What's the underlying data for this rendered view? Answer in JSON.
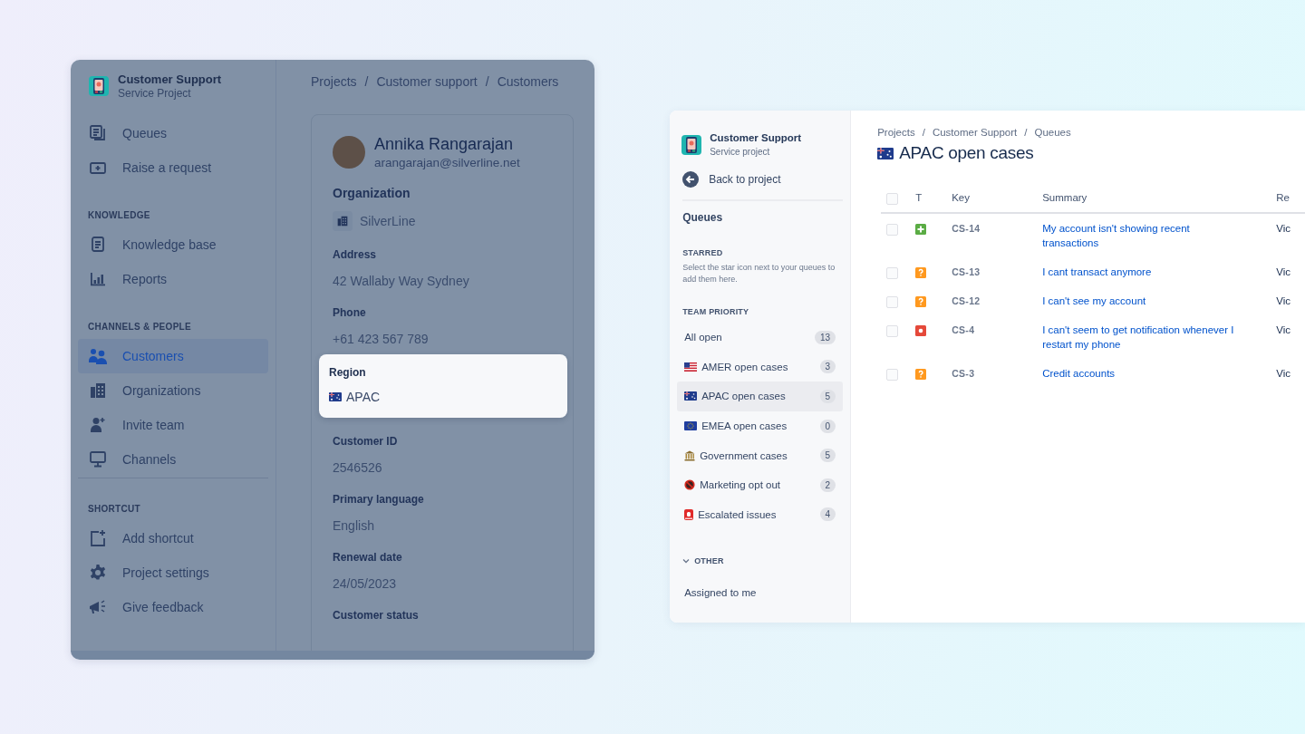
{
  "customer_window": {
    "sidebar": {
      "project": {
        "name": "Customer Support",
        "type": "Service Project"
      },
      "groups": [
        {
          "items": [
            {
              "label": "Queues",
              "selected": false
            },
            {
              "label": "Raise a request",
              "selected": false
            }
          ]
        },
        {
          "heading": "KNOWLEDGE",
          "items": [
            {
              "label": "Knowledge base",
              "selected": false
            },
            {
              "label": "Reports",
              "selected": false
            }
          ]
        },
        {
          "heading": "CHANNELS & PEOPLE",
          "items": [
            {
              "label": "Customers",
              "selected": true
            },
            {
              "label": "Organizations",
              "selected": false
            },
            {
              "label": "Invite team",
              "selected": false
            },
            {
              "label": "Channels",
              "selected": false
            }
          ]
        },
        {
          "heading": "SHORTCUT",
          "items": [
            {
              "label": "Add shortcut",
              "selected": false
            },
            {
              "label": "Project settings",
              "selected": false
            },
            {
              "label": "Give feedback",
              "selected": false
            }
          ]
        }
      ]
    },
    "breadcrumbs": [
      "Projects",
      "Customer support",
      "Customers"
    ],
    "breadcrumb_separator": "/",
    "customer": {
      "name": "Annika Rangarajan",
      "email": "arangarajan@silverline.net",
      "fields": [
        {
          "kind": "organization",
          "label": "Organization",
          "value": "SilverLine",
          "highlighted": false
        },
        {
          "kind": "text",
          "label": "Address",
          "value": "42 Wallaby Way Sydney",
          "highlighted": false
        },
        {
          "kind": "text",
          "label": "Phone",
          "value": "+61 423 567 789",
          "highlighted": false
        },
        {
          "kind": "region",
          "label": "Region",
          "value": "APAC",
          "highlighted": true
        },
        {
          "kind": "text",
          "label": "Customer ID",
          "value": "2546526",
          "highlighted": false
        },
        {
          "kind": "text",
          "label": "Primary language",
          "value": "English",
          "highlighted": false
        },
        {
          "kind": "text",
          "label": "Renewal date",
          "value": "24/05/2023",
          "highlighted": false
        },
        {
          "kind": "text",
          "label": "Customer status",
          "highlighted": false
        }
      ]
    }
  },
  "queue_window": {
    "sidebar": {
      "project": {
        "name": "Customer Support",
        "type": "Service project"
      },
      "back": "Back to project",
      "title": "Queues",
      "starred": {
        "heading": "STARRED",
        "hint": "Select the star icon next to your queues to add them here."
      },
      "team_priority": {
        "heading": "TEAM PRIORITY",
        "queues": [
          {
            "label": "All open",
            "count": "13",
            "selected": false
          },
          {
            "label": "AMER open cases",
            "count": "3",
            "selected": false
          },
          {
            "label": "APAC open cases",
            "count": "5",
            "selected": true
          },
          {
            "label": "EMEA open cases",
            "count": "0",
            "selected": false
          },
          {
            "label": "Government cases",
            "count": "5",
            "selected": false
          },
          {
            "label": "Marketing opt out",
            "count": "2",
            "selected": false
          },
          {
            "label": "Escalated issues",
            "count": "4",
            "selected": false
          }
        ]
      },
      "other": {
        "heading": "OTHER",
        "expanded": true,
        "items": [
          "Assigned to me"
        ]
      }
    },
    "breadcrumbs": [
      "Projects",
      "Customer Support",
      "Queues"
    ],
    "breadcrumb_separator": "/",
    "title": "APAC open cases",
    "table": {
      "select_all_checked": false,
      "columns": [
        "T",
        "Key",
        "Summary",
        "Re"
      ],
      "rows": [
        {
          "checked": false,
          "kind": "new-feature",
          "key": "CS-14",
          "summary": "My account isn't showing recent transactions",
          "column_5": "Vic"
        },
        {
          "checked": false,
          "kind": "question",
          "key": "CS-13",
          "summary": "I cant transact anymore",
          "column_5": "Vic"
        },
        {
          "checked": false,
          "kind": "question",
          "key": "CS-12",
          "summary": "I can't see my account",
          "column_5": "Vic"
        },
        {
          "checked": false,
          "kind": "incident",
          "key": "CS-4",
          "summary": "I can't seem to get notification whenever I restart my phone",
          "column_5": "Vic"
        },
        {
          "checked": false,
          "kind": "question",
          "key": "CS-3",
          "summary": "Credit accounts",
          "column_5": "Vic"
        }
      ]
    }
  }
}
